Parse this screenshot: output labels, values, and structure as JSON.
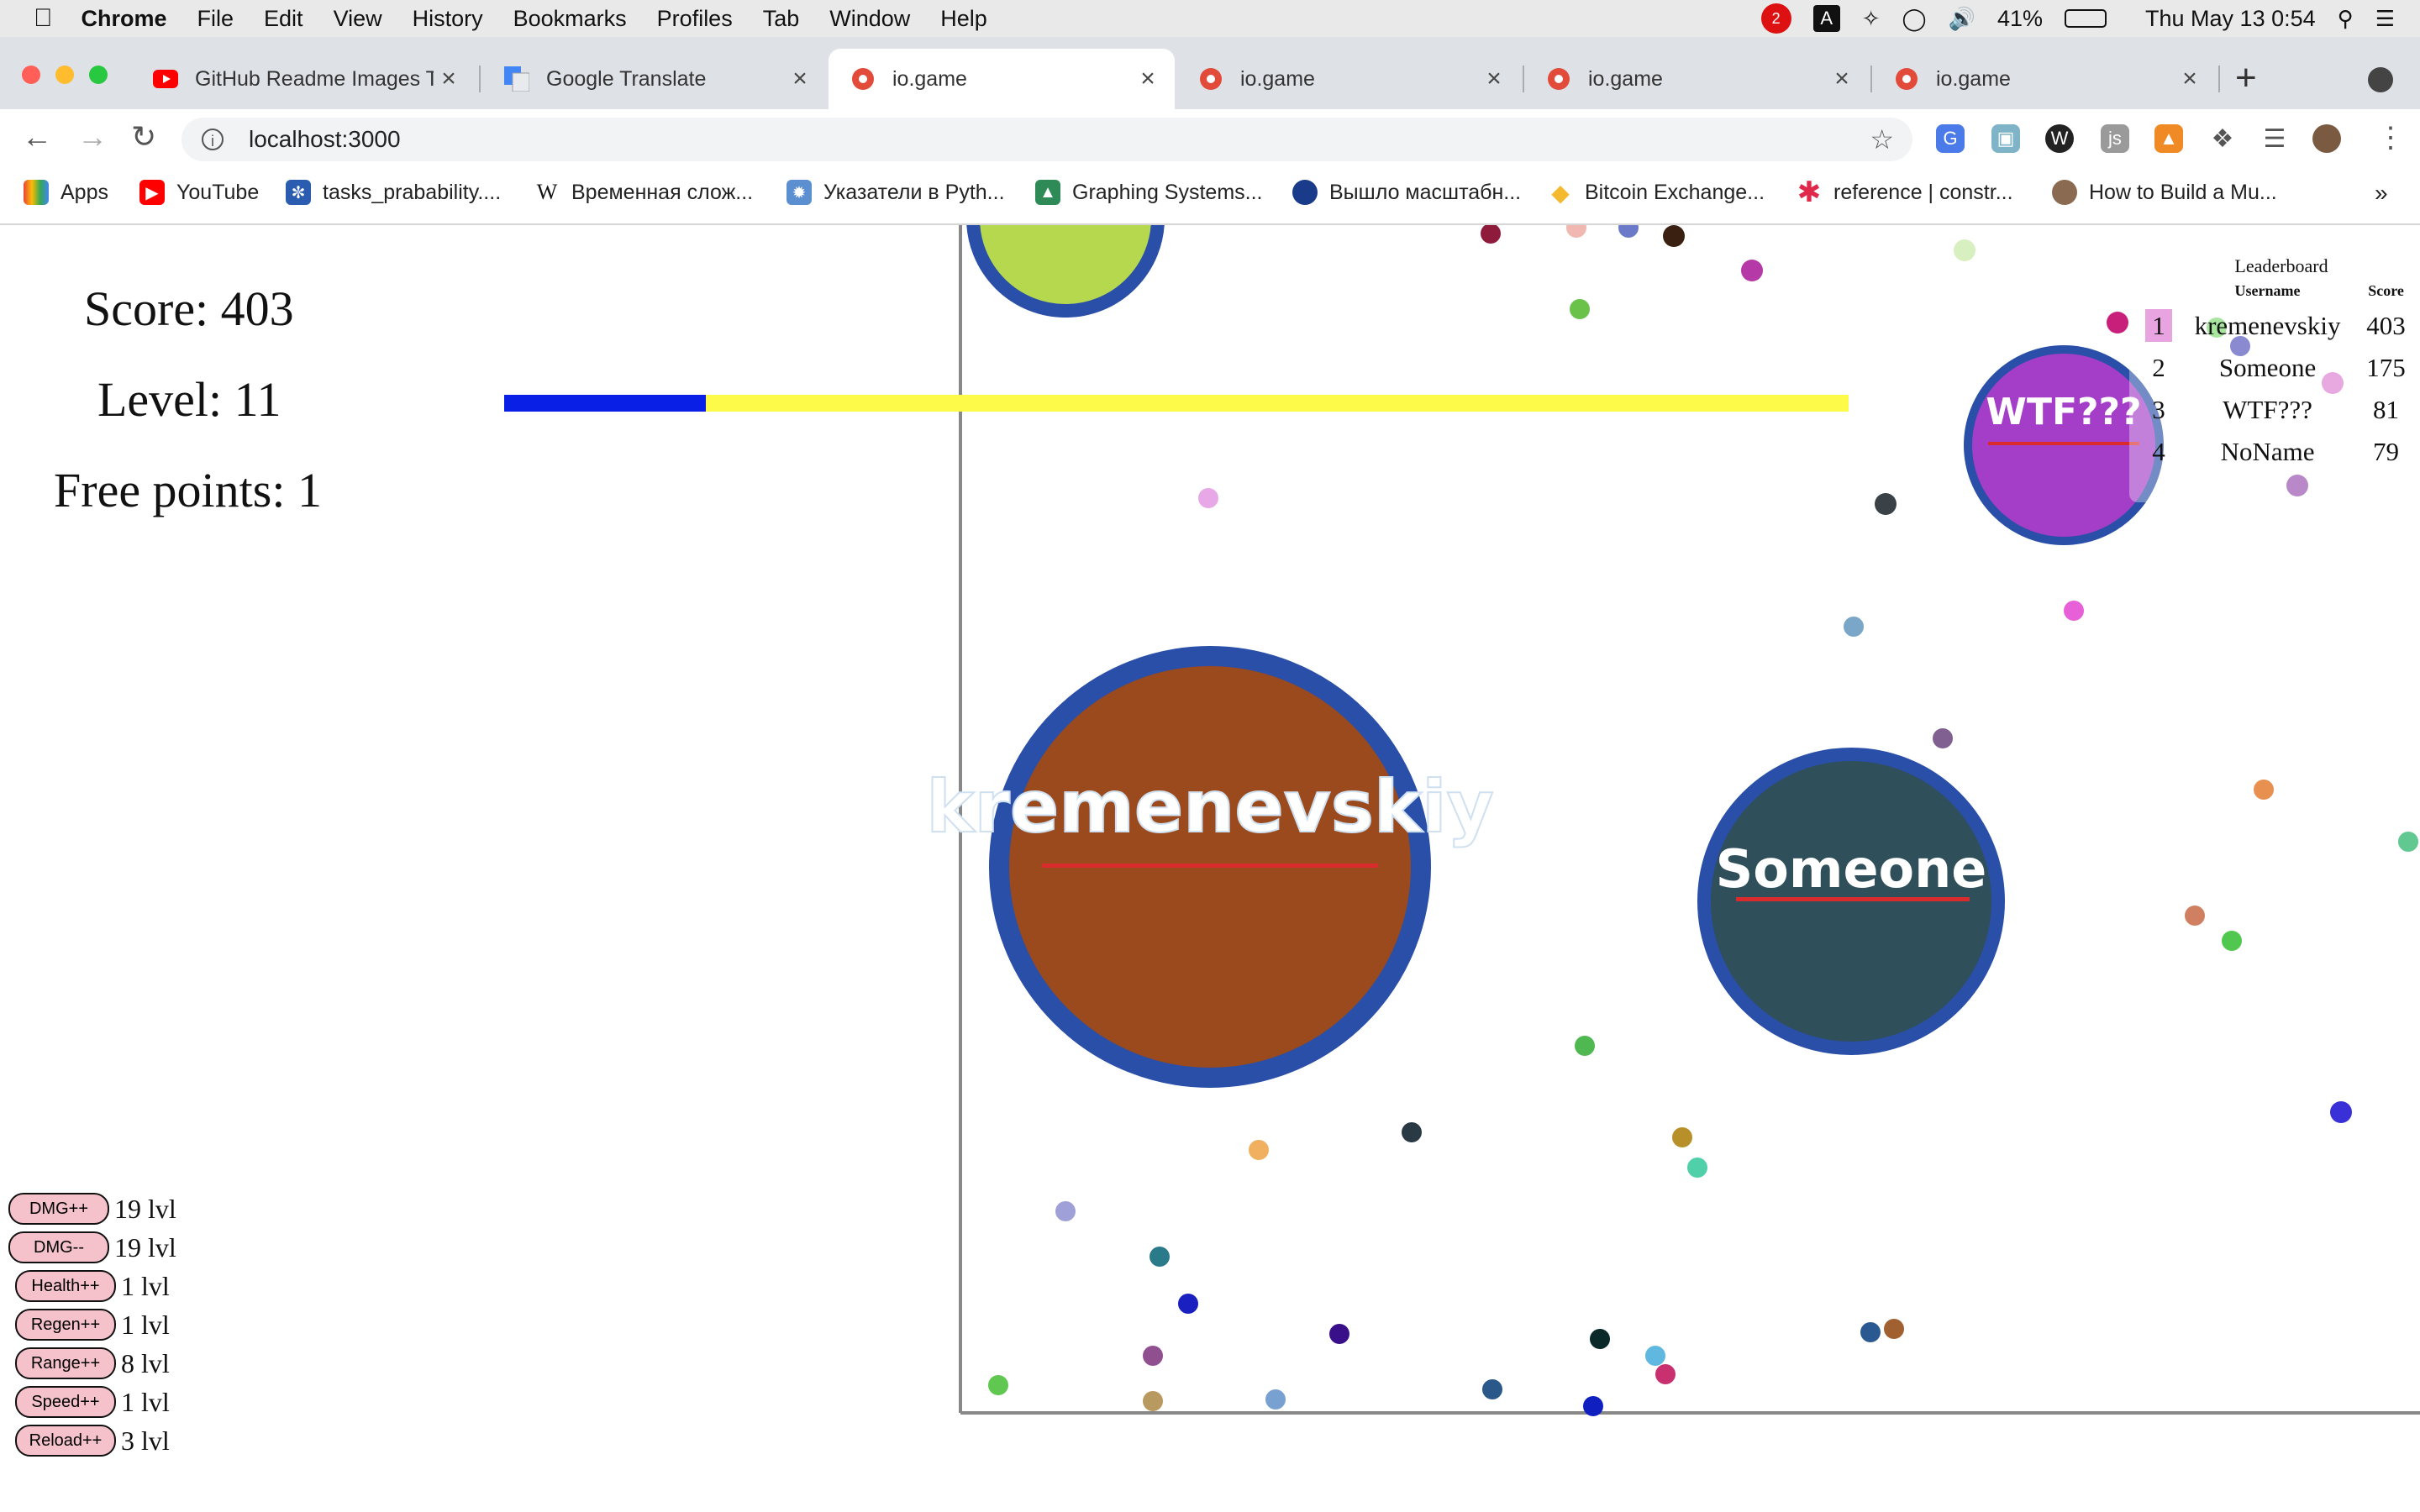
{
  "menubar": {
    "app": "Chrome",
    "items": [
      "File",
      "Edit",
      "View",
      "History",
      "Bookmarks",
      "Profiles",
      "Tab",
      "Window",
      "Help"
    ],
    "notif_badge": "2",
    "battery": "41%",
    "clock": "Thu May 13  0:54"
  },
  "tabs": [
    {
      "title": "GitHub Readme Images T",
      "icon": "youtube-icon"
    },
    {
      "title": "Google Translate",
      "icon": "google-translate-icon"
    },
    {
      "title": "io.game",
      "icon": "io-game-icon",
      "active": true
    },
    {
      "title": "io.game",
      "icon": "io-game-icon"
    },
    {
      "title": "io.game",
      "icon": "io-game-icon"
    },
    {
      "title": "io.game",
      "icon": "io-game-icon"
    }
  ],
  "toolbar": {
    "url": "localhost:3000"
  },
  "bookmarks": [
    {
      "label": "Apps",
      "icon": "apps-grid-icon"
    },
    {
      "label": "YouTube",
      "icon": "youtube-icon"
    },
    {
      "label": "tasks_prabability....",
      "icon": "stepik-icon"
    },
    {
      "label": "Временная слож...",
      "icon": "wikipedia-icon"
    },
    {
      "label": "Указатели в Pyth...",
      "icon": "site-icon"
    },
    {
      "label": "Graphing Systems...",
      "icon": "site-icon"
    },
    {
      "label": "Вышло масштабн...",
      "icon": "site-icon"
    },
    {
      "label": "Bitcoin Exchange...",
      "icon": "binance-icon"
    },
    {
      "label": "reference | constr...",
      "icon": "asterisk-icon"
    },
    {
      "label": "How to Build a Mu...",
      "icon": "avatar-icon"
    }
  ],
  "bookmarks_more": "»",
  "hud": {
    "score": "Score: 403",
    "level": "Level: 11",
    "free_points": "Free points: 1",
    "xp_progress": 0.15
  },
  "leaderboard": {
    "title": "Leaderboard",
    "headers": {
      "username": "Username",
      "score": "Score"
    },
    "rows": [
      {
        "rank": "1",
        "username": "kremenevskiy",
        "score": "403"
      },
      {
        "rank": "2",
        "username": "Someone",
        "score": "175"
      },
      {
        "rank": "3",
        "username": "WTF???",
        "score": "81"
      },
      {
        "rank": "4",
        "username": "NoName",
        "score": "79"
      }
    ]
  },
  "players": [
    {
      "name": "kremenevskiy",
      "fill": "#9a4a1c",
      "ring": "#2a4fa8"
    },
    {
      "name": "Someone",
      "fill": "#2f4f5a",
      "ring": "#2a4fa8"
    },
    {
      "name": "WTF???",
      "fill": "#a43dc8",
      "ring": "#2a4fa8"
    }
  ],
  "upgrades": [
    {
      "label": "DMG++",
      "level": "19 lvl"
    },
    {
      "label": "DMG--",
      "level": "19 lvl"
    },
    {
      "label": "Health++",
      "level": "1 lvl"
    },
    {
      "label": "Regen++",
      "level": "1 lvl"
    },
    {
      "label": "Range++",
      "level": "8 lvl"
    },
    {
      "label": "Speed++",
      "level": "1 lvl"
    },
    {
      "label": "Reload++",
      "level": "3 lvl"
    }
  ],
  "colors": {
    "xp_fill": "#0a1fe6",
    "xp_track": "#fdfa4a",
    "ring": "#2a4fa8",
    "name_underline": "#d92b2b"
  }
}
